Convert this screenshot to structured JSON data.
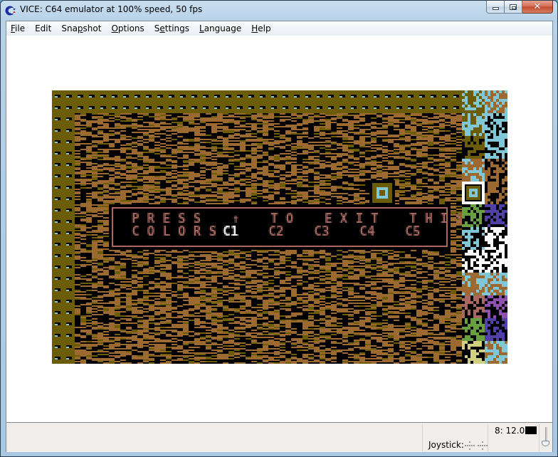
{
  "window": {
    "title": "VICE: C64 emulator at 100% speed, 50 fps",
    "app_icon": "commodore-logo-icon",
    "buttons": {
      "minimize": "minimize-icon",
      "maximize": "maximize-icon",
      "close": "close-icon"
    }
  },
  "menubar": {
    "items": [
      {
        "label": "File",
        "mnemonic": "F",
        "rest": "ile"
      },
      {
        "label": "Edit",
        "mnemonic": "",
        "rest": "Edit"
      },
      {
        "label": "Snapshot",
        "pre": "Sna",
        "mnemonic": "p",
        "rest": "shot"
      },
      {
        "label": "Options",
        "mnemonic": "O",
        "rest": "ptions"
      },
      {
        "label": "Settings",
        "pre": "S",
        "mnemonic": "e",
        "rest": "ttings"
      },
      {
        "label": "Language",
        "mnemonic": "L",
        "rest": "anguage"
      },
      {
        "label": "Help",
        "mnemonic": "H",
        "rest": "elp"
      }
    ]
  },
  "c64_screen": {
    "menu_line1": "PRESS ↑ TO EXIT THIS MENU.",
    "menu_line2_label": "COLORS",
    "color_options": [
      "C1",
      "C2",
      "C3",
      "C4",
      "C5"
    ],
    "selected_color": "C1",
    "palette": {
      "border_brown": "#6c5c05",
      "dirt_orange": "#9c6a30",
      "black": "#000000",
      "light_blue": "#80c8d8",
      "text_red": "#a86860",
      "white": "#ffffff",
      "green": "#68a040",
      "purple": "#5040a8",
      "violet": "#9050b0",
      "yellow": "#d0d080"
    },
    "tile_palette": [
      "boulder",
      "diamond-stripe",
      "brick-wall-cyan",
      "arrow-tiles",
      "brown-wall-cyan",
      "arrow-left",
      "dirt-rock",
      "dirt",
      "steel-wall-selected",
      "ladder",
      "amoeba-green",
      "amoeba-purple",
      "hook-stripes",
      "white-block",
      "white-bar-box",
      "slope",
      "dirt-block",
      "slope-cyan",
      "letter-C",
      "letter-T",
      "letter-M",
      "letter-N",
      "letter-P",
      "cyan-blob"
    ]
  },
  "statusbar": {
    "joystick_label": "Joystick:",
    "speed_readout": "8: 12.0",
    "drive_led_color": "#000000"
  }
}
